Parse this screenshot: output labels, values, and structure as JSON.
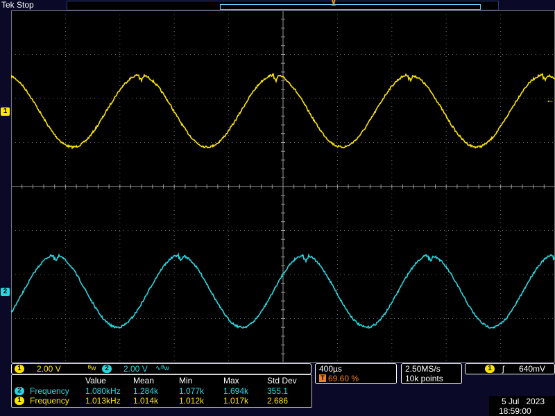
{
  "header": {
    "brand": "Tek",
    "status": "Stop"
  },
  "channels": {
    "ch1": {
      "label": "1",
      "scale": "2.00 V",
      "color": "#ffe600",
      "bw_icon": "bandwidth-limit-icon"
    },
    "ch2": {
      "label": "2",
      "scale": "2.00 V",
      "color": "#28d8e0",
      "bw_icon": "bandwidth-limit-icon",
      "ac_icon": "ac-coupling-icon"
    }
  },
  "horizontal": {
    "timebase": "400µs",
    "trigger_position": "69.60 %",
    "sample_rate": "2.50MS/s",
    "record_length": "10k points"
  },
  "trigger": {
    "source": "1",
    "slope_icon": "rising-edge-icon",
    "level": "640mV"
  },
  "measurements": {
    "headers": [
      "Value",
      "Mean",
      "Min",
      "Max",
      "Std Dev"
    ],
    "rows": [
      {
        "channel": "2",
        "name": "Frequency",
        "value": "1.080kHz",
        "mean": "1.284k",
        "min": "1.077k",
        "max": "1.694k",
        "std": "355.1"
      },
      {
        "channel": "1",
        "name": "Frequency",
        "value": "1.013kHz",
        "mean": "1.014k",
        "min": "1.012k",
        "max": "1.017k",
        "std": "2.686"
      }
    ]
  },
  "datetime": {
    "date": "5 Jul   2023",
    "time": "18:59:00"
  },
  "waveforms": {
    "ch1": {
      "color": "#ffe600",
      "frequency_hz": 1013
    },
    "ch2": {
      "color": "#28d8e0",
      "frequency_hz": 1080
    }
  },
  "markers": {
    "trigger_badge": "T",
    "trigger_arrow": "←"
  }
}
